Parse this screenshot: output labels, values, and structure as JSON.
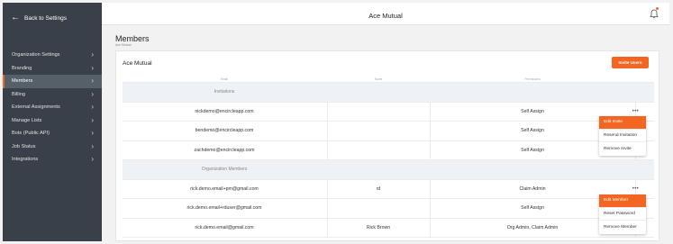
{
  "sidebar": {
    "back_label": "Back to Settings",
    "items": [
      {
        "label": "Organization Settings",
        "active": false
      },
      {
        "label": "Branding",
        "active": false
      },
      {
        "label": "Members",
        "active": true
      },
      {
        "label": "Billing",
        "active": false
      },
      {
        "label": "External Assignments",
        "active": false
      },
      {
        "label": "Manage Lists",
        "active": false
      },
      {
        "label": "Bots (Public API)",
        "active": false
      },
      {
        "label": "Job Status",
        "active": false
      },
      {
        "label": "Integrations",
        "active": false
      }
    ]
  },
  "header": {
    "title": "Ace Mutual"
  },
  "page": {
    "title": "Members",
    "subtitle": "Ace Mutual"
  },
  "card": {
    "title": "Ace Mutual",
    "invite_button": "Invite Users"
  },
  "table": {
    "columns": [
      "Email",
      "Name",
      "Permissions"
    ],
    "sections": [
      {
        "label": "Invitations",
        "rows": [
          {
            "email": "nickdemo@encircleapp.com",
            "name": "",
            "permissions": "Self Assign"
          },
          {
            "email": "bendemo@encircleapp.com",
            "name": "",
            "permissions": "Self Assign"
          },
          {
            "email": "zachdemo@encircleapp.com",
            "name": "",
            "permissions": "Self Assign"
          }
        ]
      },
      {
        "label": "Organization Members",
        "rows": [
          {
            "email": "rick.demo.email+pm@gmail.com",
            "name": "rd",
            "permissions": "Claim Admin"
          },
          {
            "email": "rick.demo.email+rduser@gmail.com",
            "name": "",
            "permissions": "Self Assign"
          },
          {
            "email": "rick.demo.email@gmail.com",
            "name": "Rick Brown",
            "permissions": "Org Admin, Claim Admin"
          }
        ]
      }
    ]
  },
  "invite_menu": [
    "Edit Invite",
    "Resend Invitation",
    "Remove Invite"
  ],
  "member_menu": [
    "Edit Member",
    "Reset Password",
    "Remove Member"
  ],
  "accent_color": "#f26622"
}
